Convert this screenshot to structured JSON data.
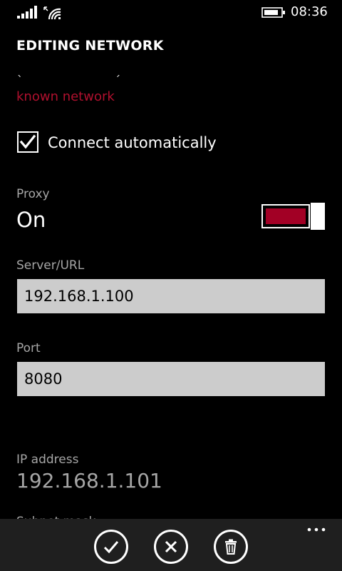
{
  "status_bar": {
    "time": "08:36",
    "icons": [
      "signal-strength-icon",
      "wifi-icon",
      "battery-icon"
    ]
  },
  "page": {
    "title": "EDITING NETWORK",
    "scroll_fragment": "` ´",
    "network_status": "known network"
  },
  "connect_automatically": {
    "label": "Connect automatically",
    "checked": true
  },
  "proxy": {
    "label": "Proxy",
    "state": "On",
    "enabled": true
  },
  "server_url": {
    "label": "Server/URL",
    "value": "192.168.1.100"
  },
  "port": {
    "label": "Port",
    "value": "8080"
  },
  "ip_address": {
    "label": "IP address",
    "value": "192.168.1.101"
  },
  "subnet": {
    "label_partial": "Subnet mask"
  },
  "app_bar": {
    "buttons": [
      "save-check-icon",
      "cancel-x-icon",
      "delete-trash-icon"
    ],
    "more": "more-options-icon"
  },
  "colors": {
    "accent": "#a20025",
    "background": "#000000",
    "textbox": "#cccccc",
    "subtle": "#a6a6a6",
    "appbar": "#1f1f1f"
  }
}
